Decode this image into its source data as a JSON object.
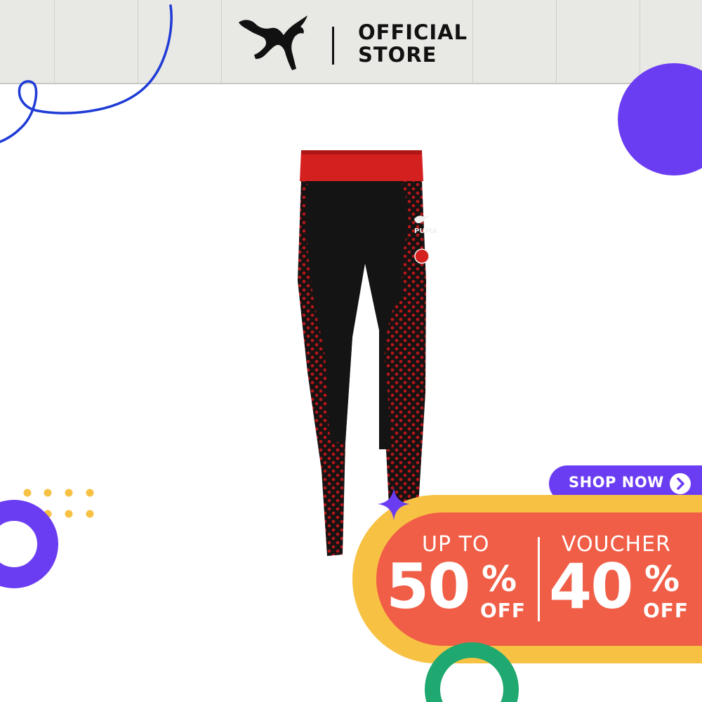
{
  "header": {
    "brand_icon": "puma-leaping-cat-icon",
    "store_line1": "OFFICIAL",
    "store_line2": "STORE"
  },
  "product": {
    "image": "red-black-polka-dot-leggings",
    "waistband_logo": "PUMA"
  },
  "promo": {
    "shop_now_label": "SHOP NOW",
    "shop_icon": "chevron-right-icon",
    "left_heading": "UP TO",
    "left_value": "50",
    "left_percent": "%",
    "left_off": "OFF",
    "right_heading": "VOUCHER",
    "right_value": "40",
    "right_percent": "%",
    "right_off": "OFF"
  },
  "colors": {
    "header_bg": "#e8e8e4",
    "purple": "#6b3df2",
    "blue_line": "#1f3bd6",
    "yellow": "#f7c244",
    "coral": "#f05e47",
    "green": "#1fa870",
    "legging_red": "#d4201f",
    "legging_black": "#141414"
  }
}
